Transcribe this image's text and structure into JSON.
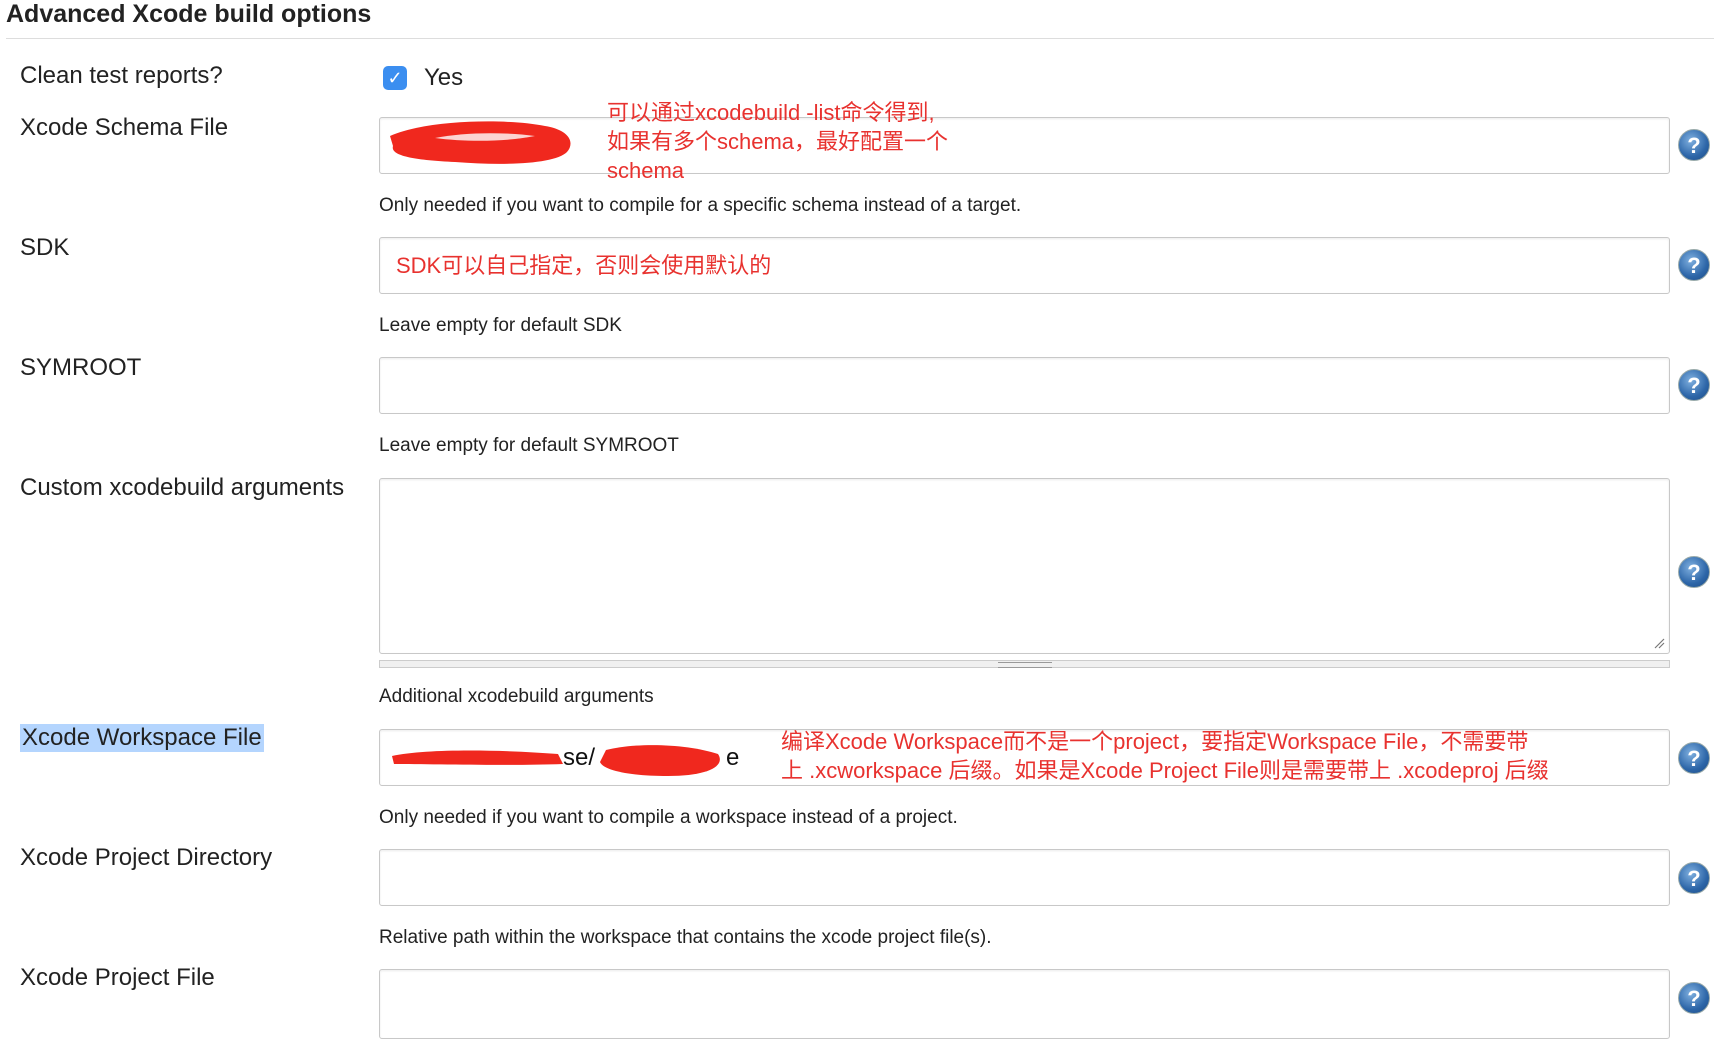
{
  "section_title": "Advanced Xcode build options",
  "clean_test_reports": {
    "label": "Clean test reports?",
    "checked": true,
    "option_label": "Yes"
  },
  "schema": {
    "label": "Xcode Schema File",
    "value_fragment": "",
    "help": "Only needed if you want to compile for a specific schema instead of a target.",
    "annotation": [
      "可以通过xcodebuild -list命令得到,",
      "如果有多个schema，最好配置一个",
      "schema"
    ]
  },
  "sdk": {
    "label": "SDK",
    "value": "SDK可以自己指定，否则会使用默认的",
    "help": "Leave empty for default SDK"
  },
  "symroot": {
    "label": "SYMROOT",
    "value": "",
    "help": "Leave empty for default SYMROOT"
  },
  "custom_args": {
    "label": "Custom xcodebuild arguments",
    "value": "",
    "help": "Additional xcodebuild arguments"
  },
  "workspace": {
    "label": "Xcode Workspace File",
    "value_fragment_1": "se/",
    "value_fragment_2": "e",
    "help": "Only needed if you want to compile a workspace instead of a project.",
    "annotation": [
      "编译Xcode Workspace而不是一个project，要指定Workspace File，不需要带",
      "上 .xcworkspace 后缀。如果是Xcode Project File则是需要带上 .xcodeproj 后缀"
    ]
  },
  "project_dir": {
    "label": "Xcode Project Directory",
    "value": "",
    "help": "Relative path within the workspace that contains the xcode project file(s)."
  },
  "project_file": {
    "label": "Xcode Project File",
    "value": ""
  },
  "help_icon": "?",
  "colors": {
    "annotation": "#e8322f",
    "checkbox": "#3b8ef0",
    "highlight": "#b4d5fe",
    "redaction": "#f0281e"
  }
}
